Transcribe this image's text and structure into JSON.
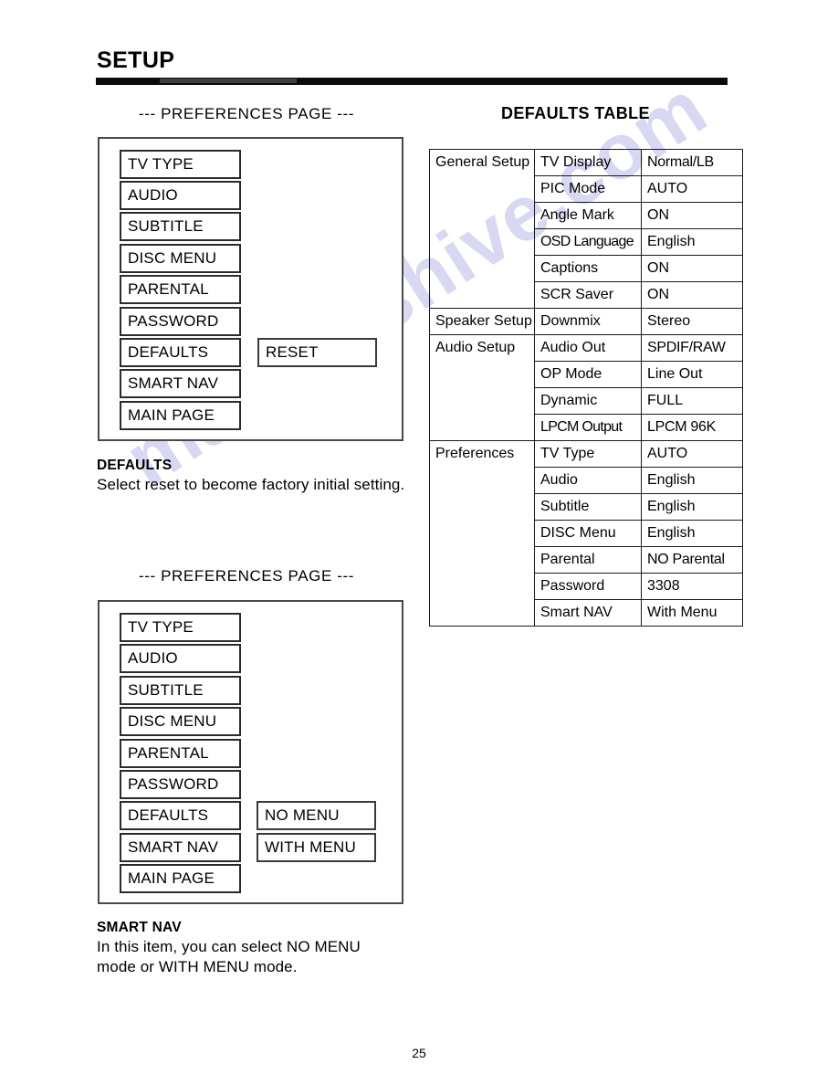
{
  "document": {
    "section_title": "SETUP",
    "page_number": "25",
    "watermark": "manualshive.com"
  },
  "panel_one": {
    "heading": "--- PREFERENCES PAGE ---",
    "menu_items": [
      "TV TYPE",
      "AUDIO",
      "SUBTITLE",
      "DISC MENU",
      "PARENTAL",
      "PASSWORD",
      "DEFAULTS",
      "SMART NAV",
      "MAIN PAGE"
    ],
    "submenu_items": [
      "RESET"
    ],
    "caption_title": "DEFAULTS",
    "caption_body": "Select reset to become factory initial setting."
  },
  "panel_two": {
    "heading": "--- PREFERENCES PAGE ---",
    "menu_items": [
      "TV TYPE",
      "AUDIO",
      "SUBTITLE",
      "DISC MENU",
      "PARENTAL",
      "PASSWORD",
      "DEFAULTS",
      "SMART NAV",
      "MAIN PAGE"
    ],
    "submenu_items": [
      "NO MENU",
      "WITH MENU"
    ],
    "caption_title": "SMART NAV",
    "caption_body": "In this item, you can select NO MENU mode or WITH MENU mode."
  },
  "defaults_table": {
    "title": "DEFAULTS TABLE",
    "groups": [
      {
        "name": "General Setup",
        "rows": [
          {
            "item": "TV Display",
            "value": "Normal/LB"
          },
          {
            "item": "PIC Mode",
            "value": "AUTO"
          },
          {
            "item": "Angle Mark",
            "value": "ON"
          },
          {
            "item": "OSD Language",
            "value": "English"
          },
          {
            "item": "Captions",
            "value": "ON"
          },
          {
            "item": "SCR Saver",
            "value": "ON"
          }
        ]
      },
      {
        "name": "Speaker Setup",
        "rows": [
          {
            "item": "Downmix",
            "value": "Stereo"
          }
        ]
      },
      {
        "name": "Audio Setup",
        "rows": [
          {
            "item": "Audio Out",
            "value": "SPDIF/RAW"
          },
          {
            "item": "OP Mode",
            "value": "Line Out"
          },
          {
            "item": "Dynamic",
            "value": "FULL"
          },
          {
            "item": "LPCM Output",
            "value": "LPCM 96K"
          }
        ]
      },
      {
        "name": "Preferences",
        "rows": [
          {
            "item": "TV Type",
            "value": "AUTO"
          },
          {
            "item": "Audio",
            "value": "English"
          },
          {
            "item": "Subtitle",
            "value": "English"
          },
          {
            "item": "DISC Menu",
            "value": "English"
          },
          {
            "item": "Parental",
            "value": "NO Parental"
          },
          {
            "item": "Password",
            "value": "3308"
          },
          {
            "item": "Smart NAV",
            "value": "With Menu"
          }
        ]
      }
    ]
  }
}
